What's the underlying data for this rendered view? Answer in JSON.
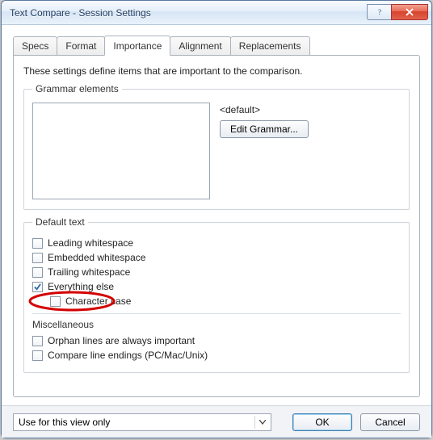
{
  "window": {
    "title": "Text Compare - Session Settings"
  },
  "tabs": [
    {
      "label": "Specs"
    },
    {
      "label": "Format"
    },
    {
      "label": "Importance"
    },
    {
      "label": "Alignment"
    },
    {
      "label": "Replacements"
    }
  ],
  "active_tab": 2,
  "description": "These settings define items that are important to the comparison.",
  "grammar": {
    "legend": "Grammar elements",
    "default_label": "<default>",
    "edit_button": "Edit Grammar..."
  },
  "default_text": {
    "legend": "Default text",
    "items": [
      {
        "label": "Leading whitespace",
        "checked": false,
        "indent": false
      },
      {
        "label": "Embedded whitespace",
        "checked": false,
        "indent": false
      },
      {
        "label": "Trailing whitespace",
        "checked": false,
        "indent": false
      },
      {
        "label": "Everything else",
        "checked": true,
        "indent": false
      },
      {
        "label": "Character case",
        "checked": false,
        "indent": true,
        "highlighted": true
      }
    ]
  },
  "misc": {
    "legend": "Miscellaneous",
    "items": [
      {
        "label": "Orphan lines are always important",
        "checked": false
      },
      {
        "label": "Compare line endings (PC/Mac/Unix)",
        "checked": false
      }
    ]
  },
  "footer": {
    "scope_selected": "Use for this view only",
    "ok": "OK",
    "cancel": "Cancel"
  }
}
